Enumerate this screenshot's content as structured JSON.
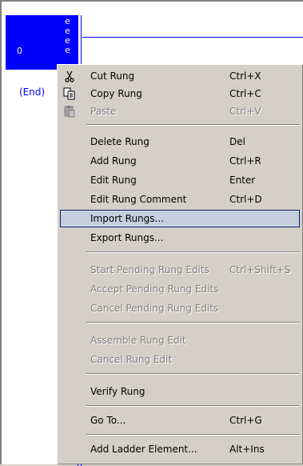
{
  "rung": {
    "number": "0",
    "e_marks": [
      "e",
      "e",
      "e",
      "e"
    ],
    "end_label": "(End)"
  },
  "context_menu": {
    "items": [
      {
        "label": "Cut Rung",
        "shortcut": "Ctrl+X",
        "icon": "scissors-icon",
        "enabled": true
      },
      {
        "label": "Copy Rung",
        "shortcut": "Ctrl+C",
        "icon": "copy-icon",
        "enabled": true
      },
      {
        "label": "Paste",
        "shortcut": "Ctrl+V",
        "icon": "paste-icon",
        "enabled": false
      },
      {
        "label": "Delete Rung",
        "shortcut": "Del",
        "enabled": true
      },
      {
        "label": "Add Rung",
        "shortcut": "Ctrl+R",
        "enabled": true
      },
      {
        "label": "Edit Rung",
        "shortcut": "Enter",
        "enabled": true
      },
      {
        "label": "Edit Rung Comment",
        "shortcut": "Ctrl+D",
        "enabled": true
      },
      {
        "label": "Import Rungs...",
        "shortcut": "",
        "enabled": true,
        "highlighted": true
      },
      {
        "label": "Export Rungs...",
        "shortcut": "",
        "enabled": true
      },
      {
        "label": "Start Pending Rung Edits",
        "shortcut": "Ctrl+Shift+S",
        "enabled": false
      },
      {
        "label": "Accept Pending Rung Edits",
        "shortcut": "",
        "enabled": false
      },
      {
        "label": "Cancel Pending Rung Edits",
        "shortcut": "",
        "enabled": false
      },
      {
        "label": "Assemble Rung Edit",
        "shortcut": "",
        "enabled": false
      },
      {
        "label": "Cancel Rung Edit",
        "shortcut": "",
        "enabled": false
      },
      {
        "label": "Verify Rung",
        "shortcut": "",
        "enabled": true
      },
      {
        "label": "Go To...",
        "shortcut": "Ctrl+G",
        "enabled": true
      },
      {
        "label": "Add Ladder Element...",
        "shortcut": "Alt+Ins",
        "enabled": true
      }
    ]
  },
  "colors": {
    "rung_highlight": "#0000ff",
    "menu_background": "#d4d0c8",
    "menu_highlight": "#c6cfde",
    "menu_highlight_border": "#0a246a",
    "disabled_text": "#808080"
  }
}
